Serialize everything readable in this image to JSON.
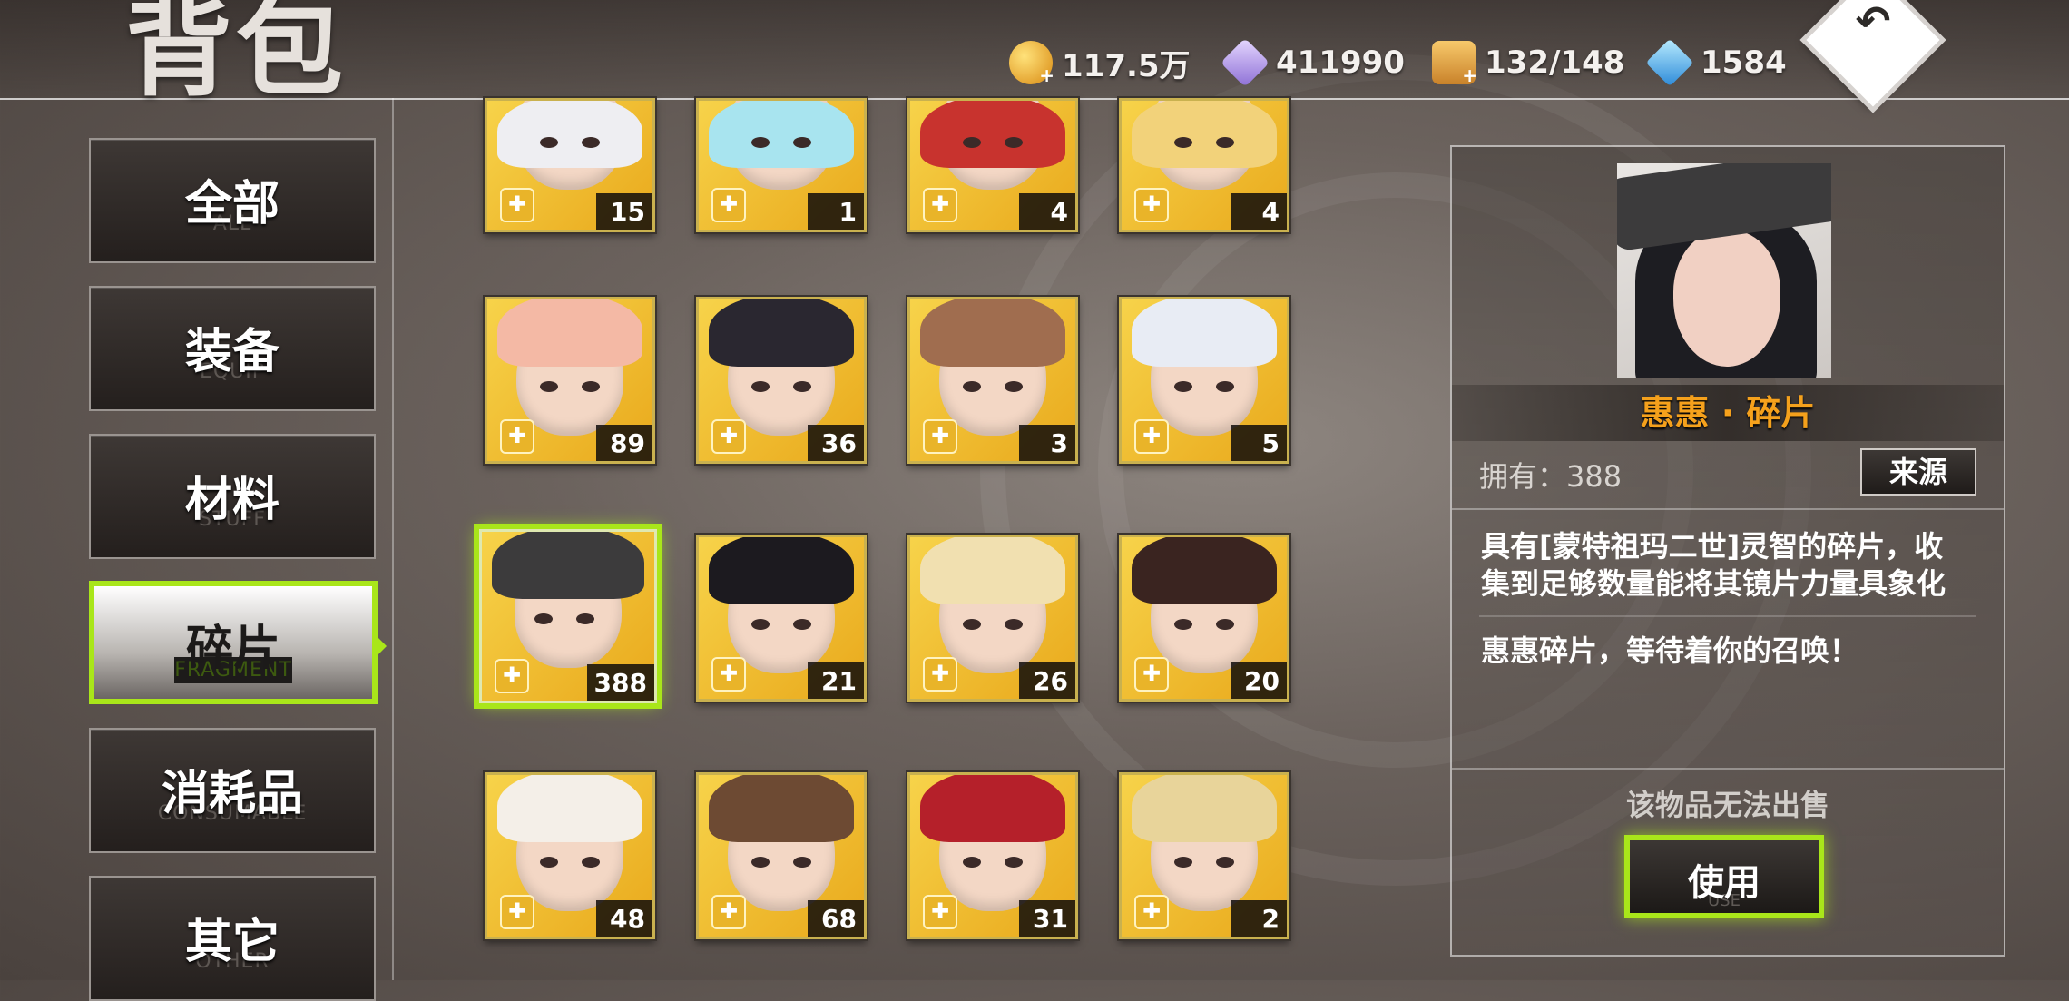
{
  "header": {
    "title": "背包",
    "resources": [
      {
        "icon": "gold-coin-icon",
        "value": "117.5万"
      },
      {
        "icon": "crystal-icon",
        "value": "411990"
      },
      {
        "icon": "chest-capacity-icon",
        "value": "132/148"
      },
      {
        "icon": "diamond-icon",
        "value": "1584"
      }
    ],
    "back_icon": "back-arrow-icon"
  },
  "categories": [
    {
      "zh": "全部",
      "en": "ALL"
    },
    {
      "zh": "装备",
      "en": "EQUIP"
    },
    {
      "zh": "材料",
      "en": "STUFF"
    },
    {
      "zh": "碎片",
      "en": "FRAGMENT"
    },
    {
      "zh": "消耗品",
      "en": "CONSUMABLE"
    },
    {
      "zh": "其它",
      "en": "OTHER"
    }
  ],
  "active_category": "碎片",
  "items": [
    {
      "count": "15"
    },
    {
      "count": "1"
    },
    {
      "count": "4"
    },
    {
      "count": "4"
    },
    {
      "count": "89"
    },
    {
      "count": "36"
    },
    {
      "count": "3"
    },
    {
      "count": "5"
    },
    {
      "count": "388"
    },
    {
      "count": "21"
    },
    {
      "count": "26"
    },
    {
      "count": "20"
    },
    {
      "count": "48"
    },
    {
      "count": "68"
    },
    {
      "count": "31"
    },
    {
      "count": "2"
    }
  ],
  "detail": {
    "name": "惠惠 · 碎片",
    "owned_label": "拥有：388",
    "source_button": "来源",
    "description_lines": [
      "具有[蒙特祖玛二世]灵智的碎片，收",
      "集到足够数量能将其镜片力量具象化"
    ],
    "flavor": "惠惠碎片，等待着你的召唤！",
    "sell_notice": "该物品无法出售",
    "use_button": {
      "zh": "使用",
      "en": "USE"
    }
  },
  "colors": {
    "accent": "#a9e61a",
    "name": "#f5a11c",
    "tile_gold": "#f0c040"
  }
}
